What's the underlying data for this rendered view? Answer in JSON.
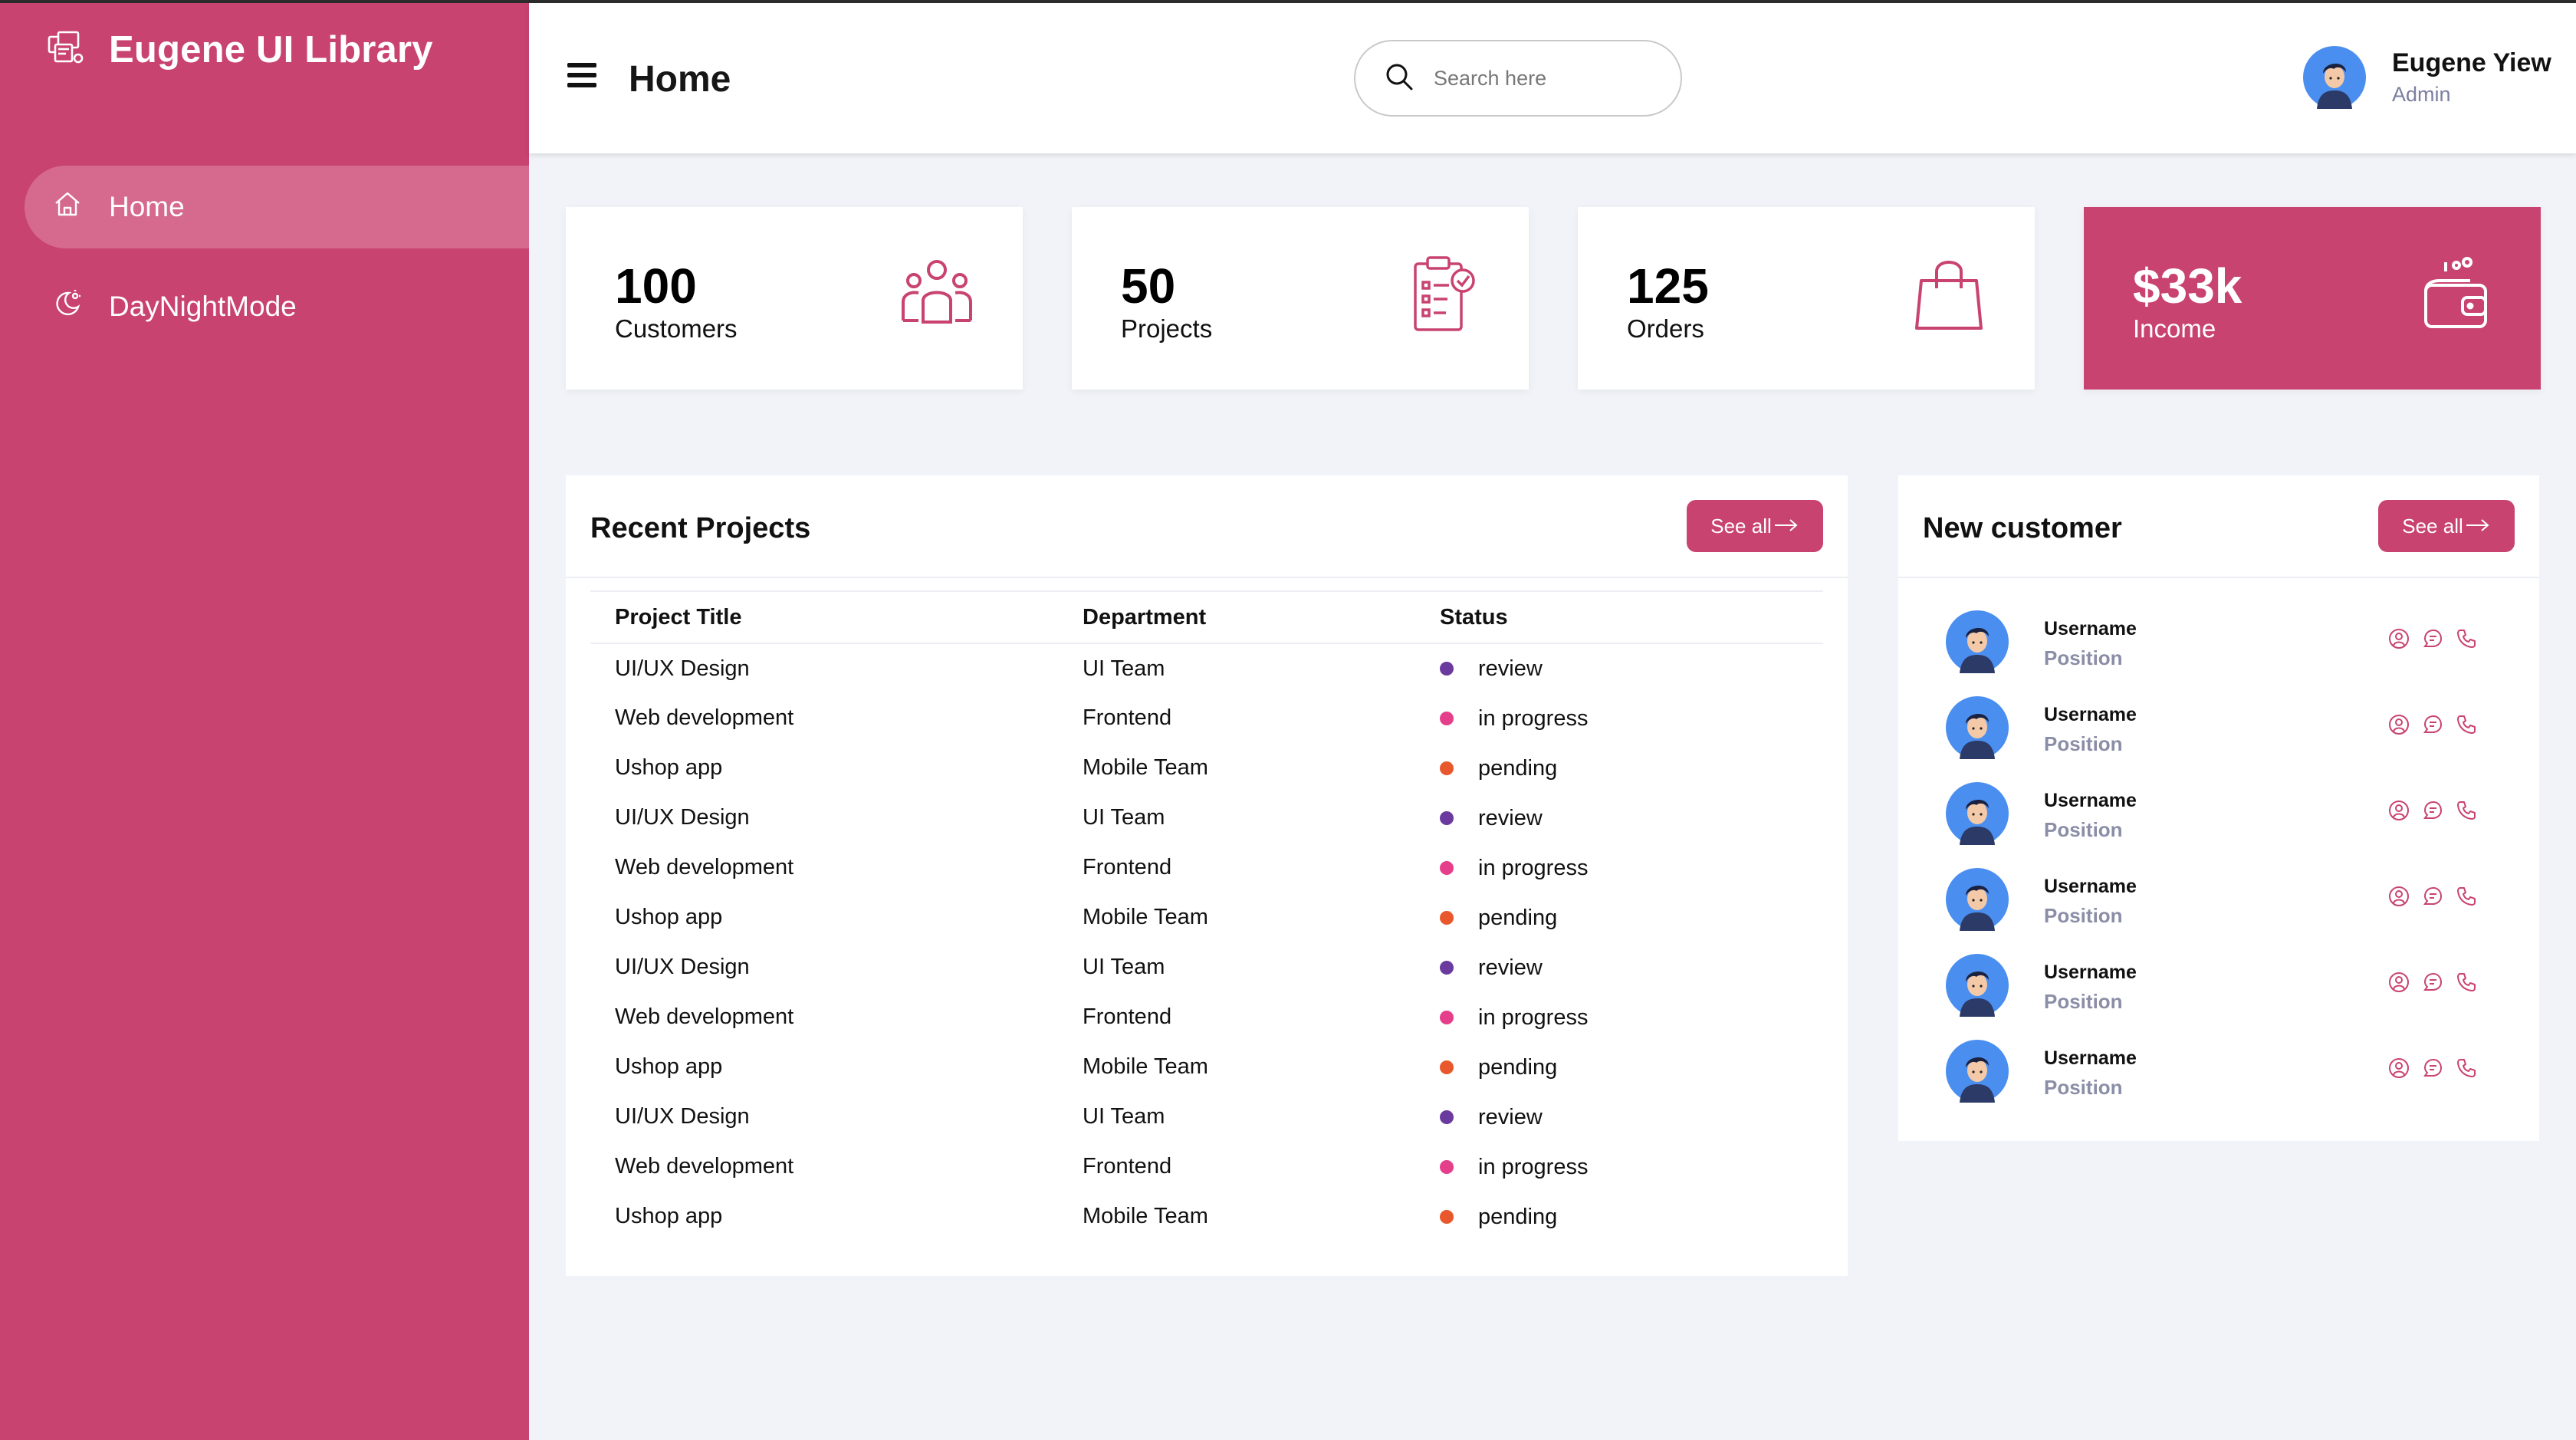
{
  "colors": {
    "accent": "#c94370",
    "sidebar_active": "#d66a8e",
    "status_review": "#6a3a9e",
    "status_in_progress": "#e53f8c",
    "status_pending": "#e8582c"
  },
  "sidebar": {
    "brand_icon": "brand-icon",
    "brand_title": "Eugene UI Library",
    "items": [
      {
        "label": "Home",
        "icon": "home-icon",
        "active": true
      },
      {
        "label": "DayNightMode",
        "icon": "day-night-icon",
        "active": false
      }
    ]
  },
  "header": {
    "title": "Home",
    "search_placeholder": "Search here",
    "user_name": "Eugene Yiew",
    "user_role": "Admin"
  },
  "cards": [
    {
      "value": "100",
      "label": "Customers",
      "icon": "people-icon"
    },
    {
      "value": "50",
      "label": "Projects",
      "icon": "clipboard-check-icon"
    },
    {
      "value": "125",
      "label": "Orders",
      "icon": "shopping-bag-icon"
    },
    {
      "value": "$33k",
      "label": "Income",
      "icon": "wallet-icon"
    }
  ],
  "recent_projects": {
    "title": "Recent Projects",
    "see_all": "See all",
    "columns": [
      "Project Title",
      "Department",
      "Status"
    ],
    "rows": [
      [
        "UI/UX Design",
        "UI Team",
        "review"
      ],
      [
        "Web development",
        "Frontend",
        "in progress"
      ],
      [
        "Ushop app",
        "Mobile Team",
        "pending"
      ],
      [
        "UI/UX Design",
        "UI Team",
        "review"
      ],
      [
        "Web development",
        "Frontend",
        "in progress"
      ],
      [
        "Ushop app",
        "Mobile Team",
        "pending"
      ],
      [
        "UI/UX Design",
        "UI Team",
        "review"
      ],
      [
        "Web development",
        "Frontend",
        "in progress"
      ],
      [
        "Ushop app",
        "Mobile Team",
        "pending"
      ],
      [
        "UI/UX Design",
        "UI Team",
        "review"
      ],
      [
        "Web development",
        "Frontend",
        "in progress"
      ],
      [
        "Ushop app",
        "Mobile Team",
        "pending"
      ]
    ]
  },
  "new_customer": {
    "title": "New customer",
    "see_all": "See all",
    "customers": [
      {
        "name": "Username",
        "position": "Position"
      },
      {
        "name": "Username",
        "position": "Position"
      },
      {
        "name": "Username",
        "position": "Position"
      },
      {
        "name": "Username",
        "position": "Position"
      },
      {
        "name": "Username",
        "position": "Position"
      },
      {
        "name": "Username",
        "position": "Position"
      }
    ]
  }
}
